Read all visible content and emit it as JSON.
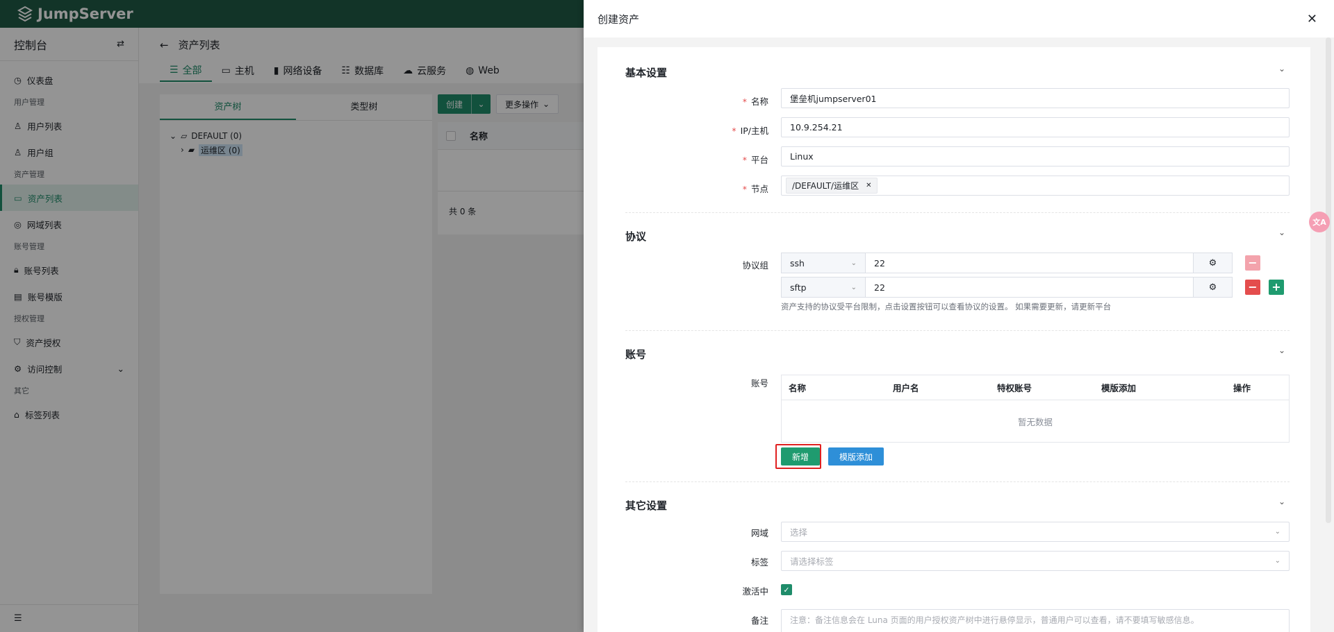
{
  "app": {
    "logo_text": "JumpServer"
  },
  "sidebar": {
    "title": "控制台",
    "groups": [
      {
        "label": "",
        "items": [
          {
            "label": "仪表盘",
            "icon": "dashboard-icon"
          }
        ]
      },
      {
        "label": "用户管理",
        "items": [
          {
            "label": "用户列表",
            "icon": "user-icon"
          },
          {
            "label": "用户组",
            "icon": "user-group-icon"
          }
        ]
      },
      {
        "label": "资产管理",
        "items": [
          {
            "label": "资产列表",
            "icon": "monitor-icon",
            "active": true
          },
          {
            "label": "网域列表",
            "icon": "location-icon"
          }
        ]
      },
      {
        "label": "账号管理",
        "items": [
          {
            "label": "账号列表",
            "icon": "lock-icon"
          },
          {
            "label": "账号模版",
            "icon": "template-icon"
          }
        ]
      },
      {
        "label": "授权管理",
        "items": [
          {
            "label": "资产授权",
            "icon": "shield-icon"
          },
          {
            "label": "访问控制",
            "icon": "gear-icon"
          }
        ]
      },
      {
        "label": "其它",
        "items": [
          {
            "label": "标签列表",
            "icon": "tag-icon"
          }
        ]
      }
    ]
  },
  "page": {
    "title": "资产列表",
    "tabs": [
      "全部",
      "主机",
      "网络设备",
      "数据库",
      "云服务",
      "Web"
    ],
    "tree_tabs": [
      "资产树",
      "类型树"
    ],
    "tree": {
      "root": "DEFAULT (0)",
      "child": "运维区 (0)"
    },
    "create_label": "创建",
    "more_label": "更多操作",
    "col_name": "名称",
    "total": "共 0 条"
  },
  "drawer": {
    "title": "创建资产",
    "basic": {
      "title": "基本设置",
      "name_label": "名称",
      "name_value": "堡垒机jumpserver01",
      "ip_label": "IP/主机",
      "ip_value": "10.9.254.21",
      "platform_label": "平台",
      "platform_value": "Linux",
      "node_label": "节点",
      "node_tag": "/DEFAULT/运维区"
    },
    "protocol": {
      "title": "协议",
      "group_label": "协议组",
      "rows": [
        {
          "name": "ssh",
          "port": "22"
        },
        {
          "name": "sftp",
          "port": "22"
        }
      ],
      "hint": "资产支持的协议受平台限制，点击设置按钮可以查看协议的设置。 如果需要更新，请更新平台"
    },
    "account": {
      "title": "账号",
      "label": "账号",
      "columns": [
        "名称",
        "用户名",
        "特权账号",
        "模版添加",
        "操作"
      ],
      "empty": "暂无数据",
      "add_label": "新增",
      "template_label": "模版添加"
    },
    "other": {
      "title": "其它设置",
      "domain_label": "网域",
      "domain_placeholder": "选择",
      "labels_label": "标签",
      "labels_placeholder": "请选择标签",
      "active_label": "激活中",
      "comment_label": "备注",
      "comment_placeholder": "注意：备注信息会在 Luna 页面的用户授权资产树中进行悬停显示，普通用户可以查看，请不要填写敏感信息。"
    }
  },
  "colors": {
    "primary": "#1f8c6a",
    "danger": "#e44d4d",
    "blue": "#2e8fd8"
  }
}
